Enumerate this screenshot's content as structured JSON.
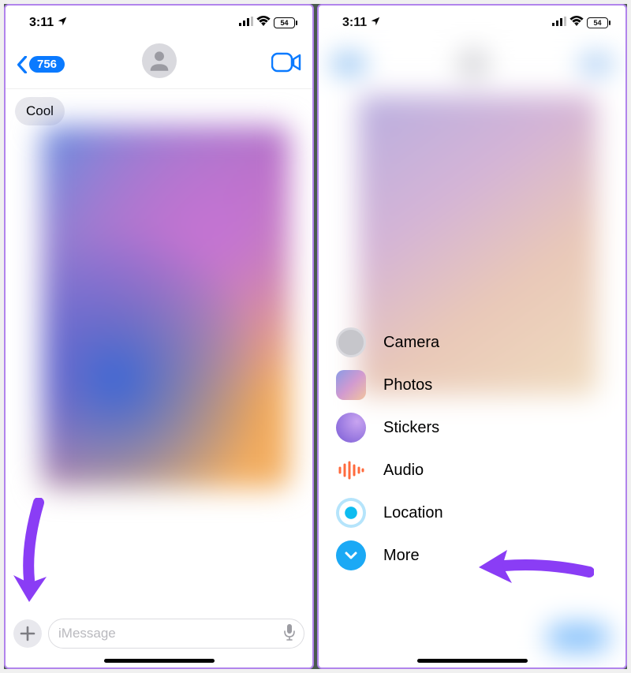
{
  "status": {
    "time": "3:11",
    "battery": "54"
  },
  "left": {
    "back_count": "756",
    "bubble_text": "Cool",
    "input_placeholder": "iMessage"
  },
  "right": {
    "menu": [
      {
        "label": "Camera"
      },
      {
        "label": "Photos"
      },
      {
        "label": "Stickers"
      },
      {
        "label": "Audio"
      },
      {
        "label": "Location"
      },
      {
        "label": "More"
      }
    ]
  }
}
